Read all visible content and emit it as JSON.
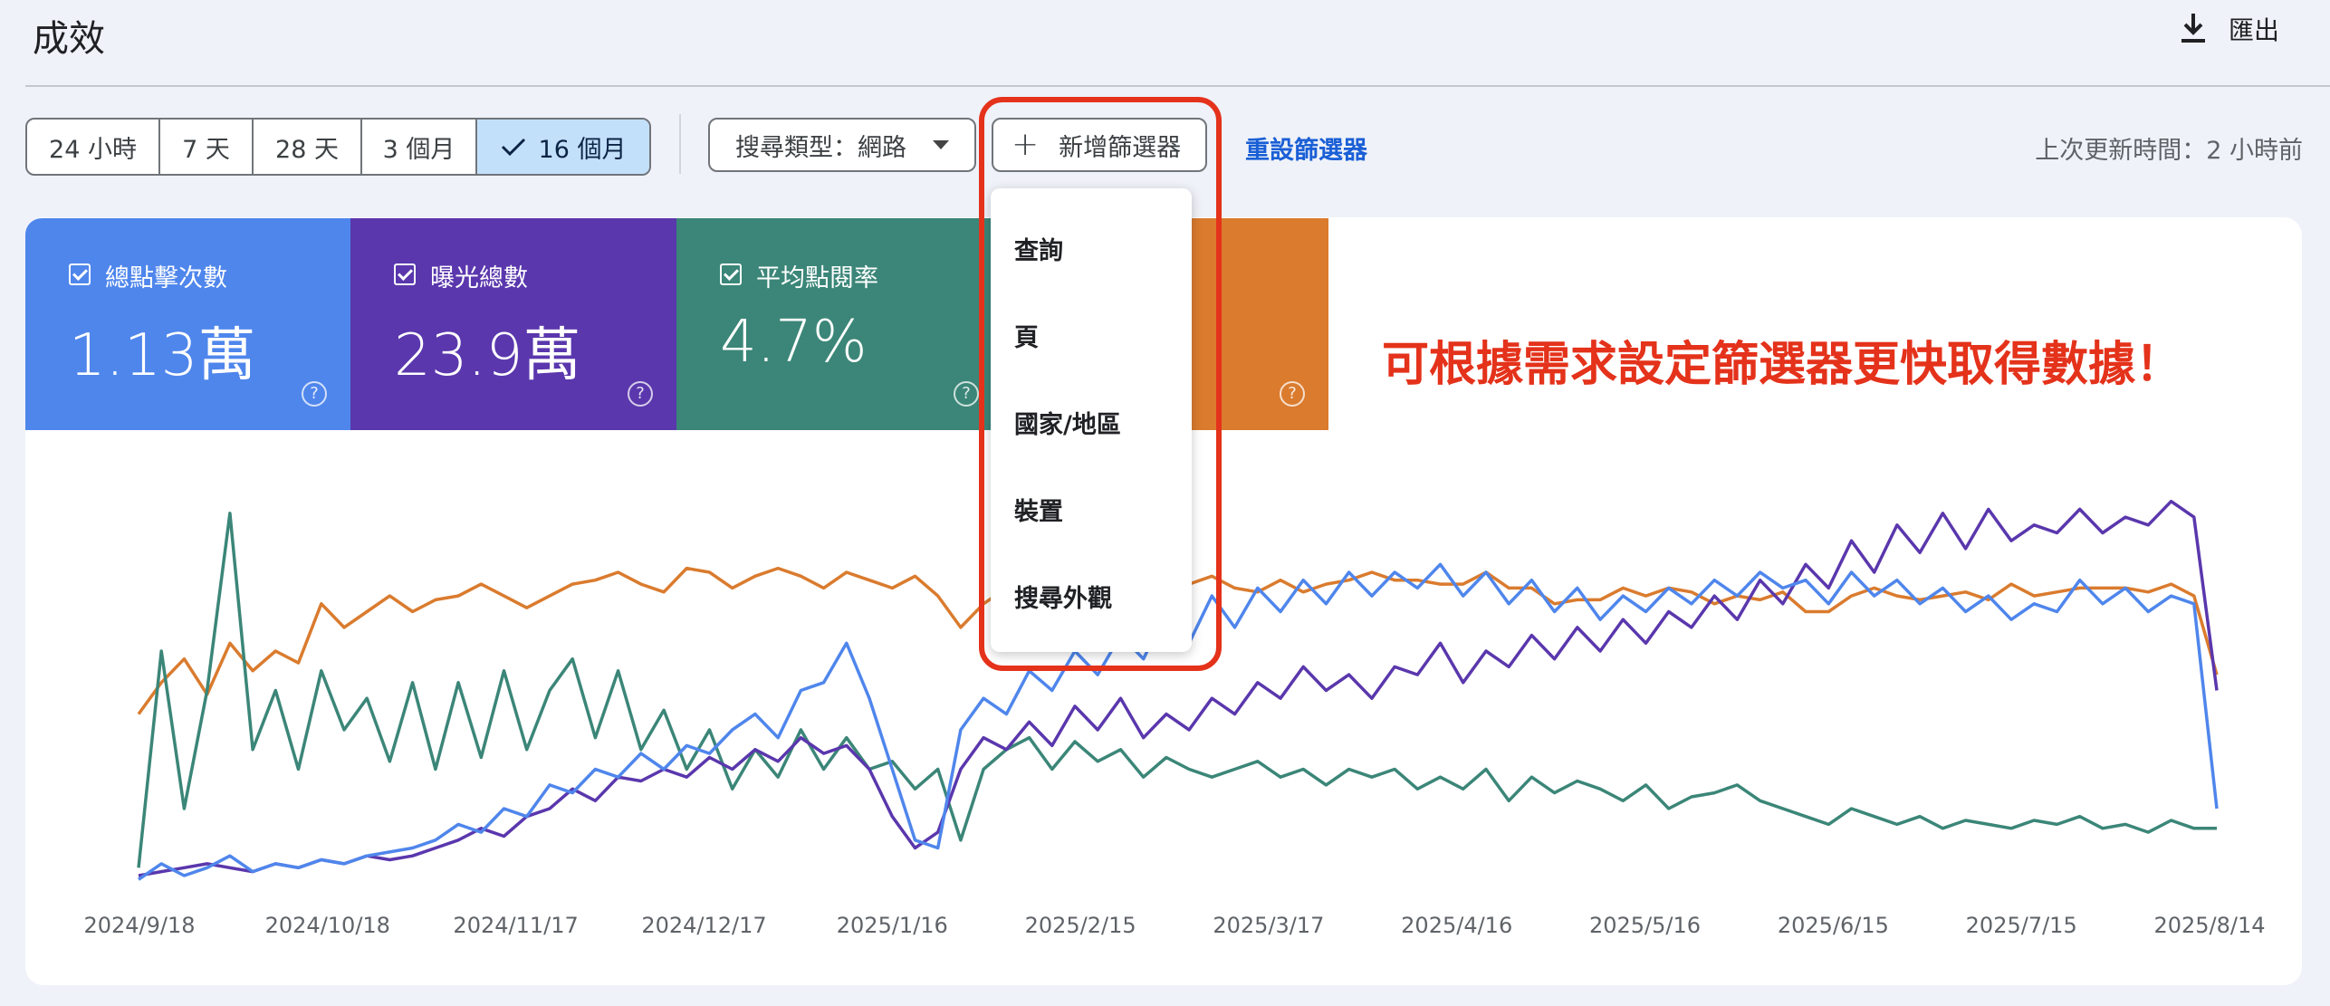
{
  "header": {
    "title": "成效",
    "export_label": "匯出"
  },
  "toolbar": {
    "date_ranges": [
      "24 小時",
      "7 天",
      "28 天",
      "3 個月",
      "16 個月"
    ],
    "active_range": "16 個月",
    "search_type": "搜尋類型：網路",
    "add_filter": "新增篩選器",
    "reset_filters": "重設篩選器",
    "last_updated": "上次更新時間：2 小時前"
  },
  "metrics": [
    {
      "label": "總點擊次數",
      "value": "1.13萬"
    },
    {
      "label": "曝光總數",
      "value": "23.9萬"
    },
    {
      "label": "平均點閱率",
      "value": "4.7%"
    }
  ],
  "help_glyph": "?",
  "filter_menu": {
    "items": [
      "查詢",
      "頁",
      "國家/地區",
      "裝置",
      "搜尋外觀"
    ]
  },
  "annotation": "可根據需求設定篩選器更快取得數據！",
  "colors": {
    "clicks": "#4f86ec",
    "impressions": "#5a37ad",
    "ctr": "#3b8678",
    "position": "#da7b2e",
    "annotation": "#e4321b",
    "active_range": "#c3e0fb",
    "link": "#1a5fd6"
  },
  "chart_data": {
    "type": "line",
    "x_tick_labels": [
      "2024/9/18",
      "2024/10/18",
      "2024/11/17",
      "2024/12/17",
      "2025/1/16",
      "2025/2/15",
      "2025/3/17",
      "2025/4/16",
      "2025/5/16",
      "2025/6/15",
      "2025/7/15",
      "2025/8/14"
    ],
    "x_range": [
      "2024/9/18",
      "2025/8/20"
    ],
    "y_normalized_range": [
      0,
      1
    ],
    "grid": false,
    "legend": "none",
    "series": [
      {
        "color": "#da7b2e",
        "values": [
          0.44,
          0.52,
          0.58,
          0.49,
          0.62,
          0.55,
          0.6,
          0.57,
          0.72,
          0.66,
          0.7,
          0.74,
          0.7,
          0.73,
          0.74,
          0.77,
          0.74,
          0.71,
          0.74,
          0.77,
          0.78,
          0.8,
          0.77,
          0.75,
          0.81,
          0.8,
          0.76,
          0.79,
          0.81,
          0.79,
          0.76,
          0.8,
          0.78,
          0.76,
          0.79,
          0.74,
          0.66,
          0.72,
          0.76,
          0.77,
          0.78,
          0.76,
          0.74,
          0.76,
          0.77,
          0.78,
          0.77,
          0.79,
          0.76,
          0.75,
          0.78,
          0.75,
          0.77,
          0.78,
          0.8,
          0.78,
          0.78,
          0.77,
          0.77,
          0.8,
          0.76,
          0.76,
          0.72,
          0.73,
          0.73,
          0.76,
          0.74,
          0.76,
          0.75,
          0.72,
          0.74,
          0.73,
          0.75,
          0.7,
          0.7,
          0.74,
          0.76,
          0.74,
          0.73,
          0.74,
          0.75,
          0.73,
          0.77,
          0.74,
          0.75,
          0.76,
          0.76,
          0.76,
          0.75,
          0.77,
          0.74,
          0.54
        ]
      },
      {
        "color": "#3b8678",
        "values": [
          0.05,
          0.6,
          0.2,
          0.5,
          0.95,
          0.35,
          0.5,
          0.3,
          0.55,
          0.4,
          0.48,
          0.32,
          0.52,
          0.3,
          0.52,
          0.33,
          0.55,
          0.35,
          0.5,
          0.58,
          0.38,
          0.55,
          0.35,
          0.45,
          0.3,
          0.4,
          0.25,
          0.35,
          0.28,
          0.4,
          0.3,
          0.38,
          0.3,
          0.32,
          0.25,
          0.3,
          0.12,
          0.3,
          0.35,
          0.38,
          0.3,
          0.37,
          0.32,
          0.35,
          0.28,
          0.33,
          0.3,
          0.28,
          0.3,
          0.32,
          0.28,
          0.3,
          0.26,
          0.3,
          0.28,
          0.3,
          0.25,
          0.28,
          0.25,
          0.3,
          0.22,
          0.28,
          0.24,
          0.27,
          0.25,
          0.22,
          0.26,
          0.2,
          0.23,
          0.24,
          0.26,
          0.22,
          0.2,
          0.18,
          0.16,
          0.2,
          0.18,
          0.16,
          0.18,
          0.15,
          0.17,
          0.16,
          0.15,
          0.17,
          0.16,
          0.18,
          0.15,
          0.16,
          0.14,
          0.17,
          0.15,
          0.15
        ]
      },
      {
        "color": "#5a37ad",
        "values": [
          0.03,
          0.04,
          0.05,
          0.06,
          0.05,
          0.04,
          0.06,
          0.05,
          0.07,
          0.06,
          0.08,
          0.07,
          0.08,
          0.1,
          0.12,
          0.15,
          0.13,
          0.18,
          0.2,
          0.25,
          0.22,
          0.28,
          0.27,
          0.3,
          0.28,
          0.33,
          0.3,
          0.35,
          0.32,
          0.38,
          0.34,
          0.36,
          0.3,
          0.18,
          0.1,
          0.14,
          0.3,
          0.38,
          0.35,
          0.42,
          0.36,
          0.46,
          0.4,
          0.48,
          0.38,
          0.44,
          0.4,
          0.48,
          0.44,
          0.52,
          0.48,
          0.56,
          0.5,
          0.54,
          0.48,
          0.56,
          0.54,
          0.62,
          0.52,
          0.6,
          0.56,
          0.64,
          0.58,
          0.66,
          0.6,
          0.68,
          0.62,
          0.7,
          0.66,
          0.74,
          0.68,
          0.78,
          0.72,
          0.82,
          0.76,
          0.88,
          0.8,
          0.92,
          0.85,
          0.95,
          0.86,
          0.96,
          0.88,
          0.92,
          0.9,
          0.96,
          0.9,
          0.94,
          0.92,
          0.98,
          0.94,
          0.5
        ]
      },
      {
        "color": "#4f86ec",
        "values": [
          0.02,
          0.06,
          0.03,
          0.05,
          0.08,
          0.04,
          0.06,
          0.05,
          0.07,
          0.06,
          0.08,
          0.09,
          0.1,
          0.12,
          0.16,
          0.14,
          0.2,
          0.18,
          0.26,
          0.24,
          0.3,
          0.28,
          0.34,
          0.3,
          0.36,
          0.34,
          0.4,
          0.44,
          0.38,
          0.5,
          0.52,
          0.62,
          0.48,
          0.3,
          0.12,
          0.1,
          0.4,
          0.48,
          0.44,
          0.55,
          0.5,
          0.6,
          0.54,
          0.64,
          0.58,
          0.7,
          0.62,
          0.74,
          0.66,
          0.76,
          0.7,
          0.78,
          0.72,
          0.8,
          0.74,
          0.8,
          0.76,
          0.82,
          0.74,
          0.8,
          0.72,
          0.78,
          0.7,
          0.76,
          0.68,
          0.74,
          0.7,
          0.76,
          0.72,
          0.78,
          0.74,
          0.8,
          0.76,
          0.78,
          0.72,
          0.8,
          0.74,
          0.78,
          0.72,
          0.76,
          0.7,
          0.74,
          0.68,
          0.72,
          0.7,
          0.78,
          0.72,
          0.76,
          0.7,
          0.74,
          0.72,
          0.2
        ]
      }
    ]
  }
}
